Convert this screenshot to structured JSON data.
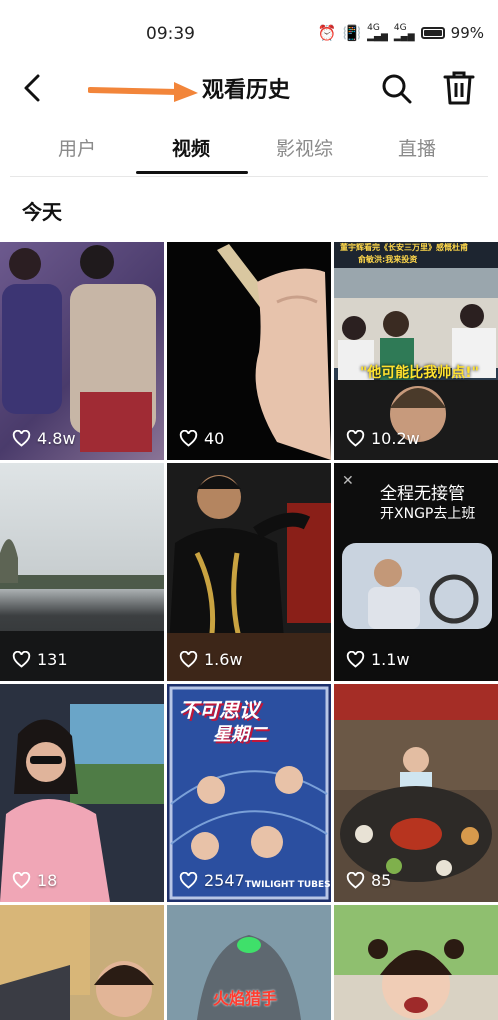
{
  "status_bar": {
    "time": "09:39",
    "battery": "99%"
  },
  "header": {
    "title": "观看历史"
  },
  "tabs": [
    {
      "label": "用户"
    },
    {
      "label": "视频"
    },
    {
      "label": "影视综"
    },
    {
      "label": "直播"
    }
  ],
  "section_label": "今天",
  "videos": [
    {
      "likes": "4.8w"
    },
    {
      "likes": "40"
    },
    {
      "likes": "10.2w",
      "top_caption": "董宇辉看完《长安三万里》感慨杜甫",
      "top_subcaption": "俞敏洪:我来投资",
      "caption": "\"他可能比我帅点!\""
    },
    {
      "likes": "131"
    },
    {
      "likes": "1.6w"
    },
    {
      "likes": "1.1w",
      "line1": "全程无接管",
      "line2": "开XNGP去上班"
    },
    {
      "likes": "18"
    },
    {
      "likes": "2547",
      "poster_title": "不可思议",
      "poster_sub": "星期二",
      "poster_footer": "TWILIGHT TUBES"
    },
    {
      "likes": "85"
    },
    {
      "likes": ""
    },
    {
      "likes": "",
      "caption": "火焰猎手"
    },
    {
      "likes": ""
    }
  ]
}
